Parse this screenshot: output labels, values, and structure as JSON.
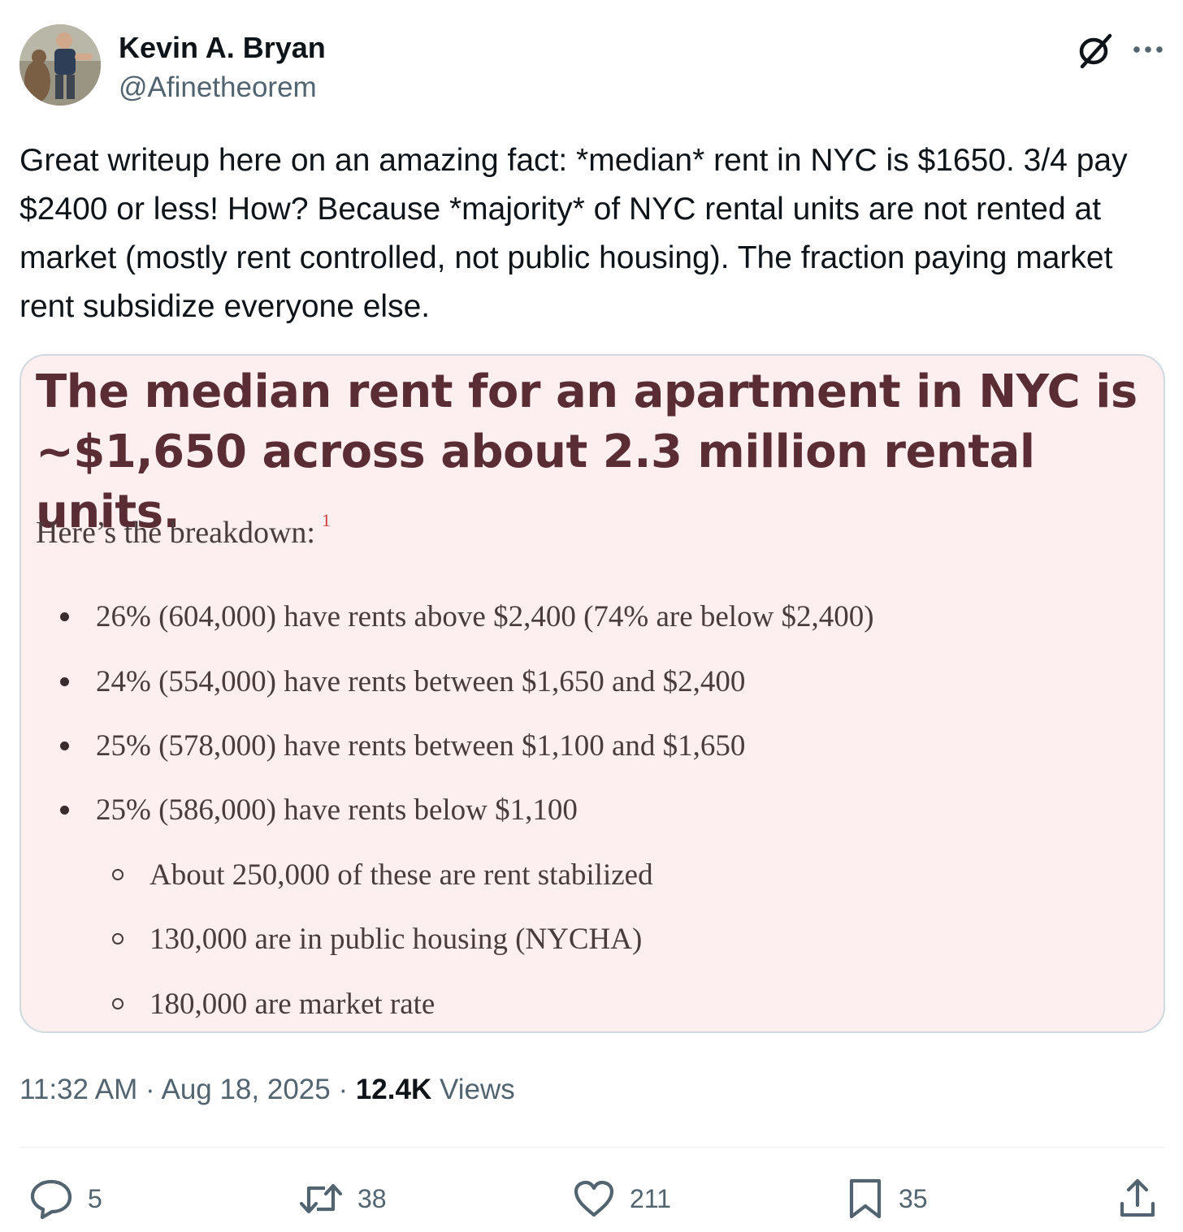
{
  "author": {
    "name": "Kevin A. Bryan",
    "handle": "@Afinetheorem"
  },
  "tweet": {
    "text": "Great writeup here on an amazing fact: *median* rent in NYC is $1650. 3/4 pay $2400 or less! How? Because *majority* of NYC rental units are not rented at market (mostly rent controlled, not public housing). The fraction paying market rent subsidize everyone else."
  },
  "card": {
    "title": "The median rent for an apartment in NYC is ~$1,650 across about 2.3 million rental units.",
    "breakdown_label": "Here’s the breakdown:",
    "footnote": "1",
    "bullets": [
      "26% (604,000) have rents above $2,400 (74% are below $2,400)",
      "24% (554,000) have rents between $1,650 and $2,400",
      "25% (578,000) have rents between $1,100 and $1,650",
      "25% (586,000) have rents below $1,100"
    ],
    "sub_bullets": [
      "About 250,000 of these are rent stabilized",
      "130,000 are in public housing (NYCHA)",
      "180,000 are market rate"
    ]
  },
  "meta": {
    "time": "11:32 AM",
    "separator": "·",
    "date": "Aug 18, 2025",
    "views_count": "12.4K",
    "views_label": "Views"
  },
  "actions": {
    "replies": "5",
    "reposts": "38",
    "likes": "211",
    "bookmarks": "35"
  },
  "icons": {
    "header": [
      "grok-icon",
      "more-icon"
    ],
    "actions": [
      "reply-icon",
      "repost-icon",
      "like-icon",
      "bookmark-icon",
      "share-icon"
    ]
  },
  "colors": {
    "text_primary": "#0f1419",
    "text_secondary": "#536471",
    "card_background": "#fdeff0",
    "card_title": "#5a2d35",
    "footnote": "#d0413f"
  }
}
